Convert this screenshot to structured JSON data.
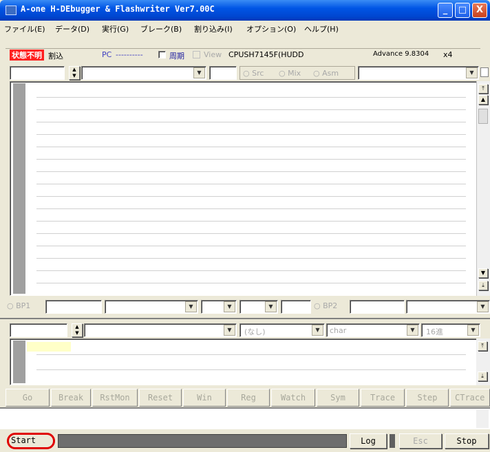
{
  "window": {
    "title": "A-one H-DEbugger & Flashwriter Ver7.00C",
    "controls": {
      "minimize": "_",
      "maximize": "□",
      "close": "X"
    }
  },
  "menu": [
    "ファイル(E)",
    "データ(D)",
    "実行(G)",
    "ブレーク(B)",
    "割り込み(I)",
    "オプション(O)",
    "ヘルプ(H)"
  ],
  "status": {
    "state_label": "状態不明",
    "interrupt_label": "割込",
    "pc_label": "PC",
    "pc_value": "----------",
    "period_label": "周期",
    "view_label": "View",
    "cpu": "CPUSH7145F(HUDD",
    "version": "Advance 9.8304",
    "multiplier": "x4"
  },
  "source_view": {
    "modes": [
      "Src",
      "Mix",
      "Asm"
    ]
  },
  "breakpoints": {
    "bp1": "BP1",
    "bp2": "BP2"
  },
  "watch": {
    "none_option": "(なし)",
    "type": "char",
    "radix": "16進"
  },
  "toolbar": [
    "Go",
    "Break",
    "RstMon",
    "Reset",
    "Win",
    "Reg",
    "Watch",
    "Sym",
    "Trace",
    "Step",
    "CTrace"
  ],
  "bottom": {
    "start": "Start",
    "log": "Log",
    "esc": "Esc",
    "stop": "Stop"
  },
  "colors": {
    "title_bar": "#0055e5",
    "state_badge": "#ff2020",
    "highlight_ring": "#e00000",
    "editor_gutter": "#a0a0a0"
  }
}
